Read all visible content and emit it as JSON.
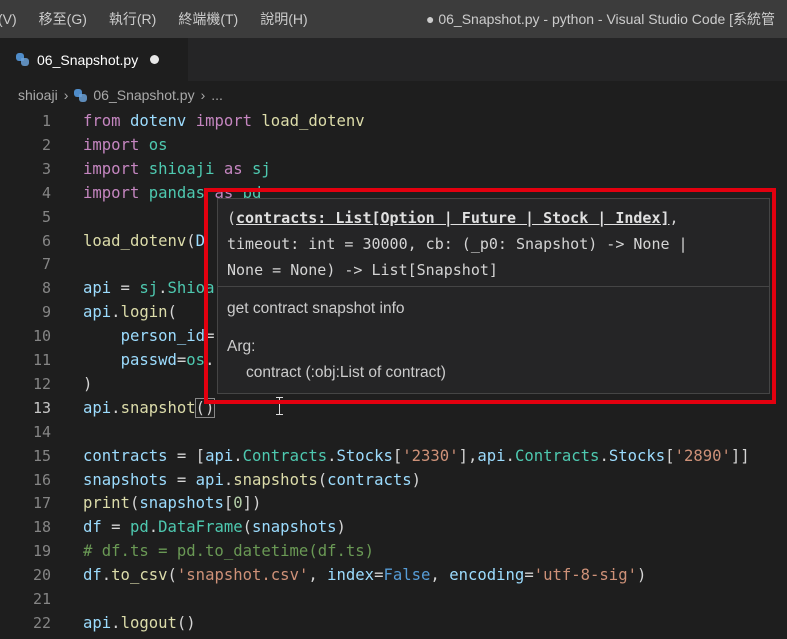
{
  "window": {
    "menu": [
      "(V)",
      "移至(G)",
      "執行(R)",
      "終端機(T)",
      "說明(H)"
    ],
    "title": "● 06_Snapshot.py - python - Visual Studio Code [系統管"
  },
  "tab": {
    "label": "06_Snapshot.py"
  },
  "breadcrumb": {
    "folder": "shioaji",
    "file": "06_Snapshot.py",
    "more": "...",
    "separator": "›"
  },
  "editor": {
    "active_line": 13,
    "lines": [
      {
        "n": "1",
        "tokens": [
          [
            "kw",
            "from"
          ],
          [
            "op",
            " "
          ],
          [
            "var",
            "dotenv"
          ],
          [
            "op",
            " "
          ],
          [
            "kw",
            "import"
          ],
          [
            "op",
            " "
          ],
          [
            "fn",
            "load_dotenv"
          ]
        ]
      },
      {
        "n": "2",
        "tokens": [
          [
            "kw",
            "import"
          ],
          [
            "op",
            " "
          ],
          [
            "cls",
            "os"
          ]
        ]
      },
      {
        "n": "3",
        "tokens": [
          [
            "kw",
            "import"
          ],
          [
            "op",
            " "
          ],
          [
            "cls",
            "shioaji"
          ],
          [
            "op",
            " "
          ],
          [
            "kw",
            "as"
          ],
          [
            "op",
            " "
          ],
          [
            "cls",
            "sj"
          ]
        ]
      },
      {
        "n": "4",
        "tokens": [
          [
            "kw",
            "import"
          ],
          [
            "op",
            " "
          ],
          [
            "cls",
            "pandas"
          ],
          [
            "op",
            " "
          ],
          [
            "kw",
            "as"
          ],
          [
            "op",
            " "
          ],
          [
            "cls",
            "pd"
          ]
        ]
      },
      {
        "n": "5",
        "tokens": []
      },
      {
        "n": "6",
        "tokens": [
          [
            "fn",
            "load_dotenv"
          ],
          [
            "op",
            "("
          ],
          [
            "var",
            "D"
          ]
        ]
      },
      {
        "n": "7",
        "tokens": []
      },
      {
        "n": "8",
        "tokens": [
          [
            "var",
            "api"
          ],
          [
            "op",
            " = "
          ],
          [
            "cls",
            "sj"
          ],
          [
            "op",
            "."
          ],
          [
            "cls",
            "Shioa"
          ]
        ]
      },
      {
        "n": "9",
        "tokens": [
          [
            "var",
            "api"
          ],
          [
            "op",
            "."
          ],
          [
            "fn",
            "login"
          ],
          [
            "op",
            "("
          ]
        ]
      },
      {
        "n": "10",
        "tokens": [
          [
            "op",
            "    "
          ],
          [
            "var",
            "person_id"
          ],
          [
            "op",
            "="
          ]
        ]
      },
      {
        "n": "11",
        "tokens": [
          [
            "op",
            "    "
          ],
          [
            "var",
            "passwd"
          ],
          [
            "op",
            "="
          ],
          [
            "cls",
            "os"
          ],
          [
            "op",
            "."
          ]
        ]
      },
      {
        "n": "12",
        "tokens": [
          [
            "op",
            ")"
          ]
        ]
      },
      {
        "n": "13",
        "tokens": [
          [
            "var",
            "api"
          ],
          [
            "op",
            "."
          ],
          [
            "fn",
            "snapshot"
          ],
          [
            "cursor",
            "()"
          ]
        ]
      },
      {
        "n": "14",
        "tokens": []
      },
      {
        "n": "15",
        "tokens": [
          [
            "var",
            "contracts"
          ],
          [
            "op",
            " = ["
          ],
          [
            "var",
            "api"
          ],
          [
            "op",
            "."
          ],
          [
            "cls",
            "Contracts"
          ],
          [
            "op",
            "."
          ],
          [
            "var",
            "Stocks"
          ],
          [
            "op",
            "["
          ],
          [
            "str",
            "'2330'"
          ],
          [
            "op",
            "],"
          ],
          [
            "var",
            "api"
          ],
          [
            "op",
            "."
          ],
          [
            "cls",
            "Contracts"
          ],
          [
            "op",
            "."
          ],
          [
            "var",
            "Stocks"
          ],
          [
            "op",
            "["
          ],
          [
            "str",
            "'2890'"
          ],
          [
            "op",
            "]]"
          ]
        ]
      },
      {
        "n": "16",
        "tokens": [
          [
            "var",
            "snapshots"
          ],
          [
            "op",
            " = "
          ],
          [
            "var",
            "api"
          ],
          [
            "op",
            "."
          ],
          [
            "fn",
            "snapshots"
          ],
          [
            "op",
            "("
          ],
          [
            "var",
            "contracts"
          ],
          [
            "op",
            ")"
          ]
        ]
      },
      {
        "n": "17",
        "tokens": [
          [
            "fn",
            "print"
          ],
          [
            "op",
            "("
          ],
          [
            "var",
            "snapshots"
          ],
          [
            "op",
            "["
          ],
          [
            "num",
            "0"
          ],
          [
            "op",
            "])"
          ]
        ]
      },
      {
        "n": "18",
        "tokens": [
          [
            "var",
            "df"
          ],
          [
            "op",
            " = "
          ],
          [
            "cls",
            "pd"
          ],
          [
            "op",
            "."
          ],
          [
            "cls",
            "DataFrame"
          ],
          [
            "op",
            "("
          ],
          [
            "var",
            "snapshots"
          ],
          [
            "op",
            ")"
          ]
        ]
      },
      {
        "n": "19",
        "tokens": [
          [
            "cm",
            "# df.ts = pd.to_datetime(df.ts)"
          ]
        ]
      },
      {
        "n": "20",
        "tokens": [
          [
            "var",
            "df"
          ],
          [
            "op",
            "."
          ],
          [
            "fn",
            "to_csv"
          ],
          [
            "op",
            "("
          ],
          [
            "str",
            "'snapshot.csv'"
          ],
          [
            "op",
            ", "
          ],
          [
            "var",
            "index"
          ],
          [
            "op",
            "="
          ],
          [
            "bool",
            "False"
          ],
          [
            "op",
            ", "
          ],
          [
            "var",
            "encoding"
          ],
          [
            "op",
            "="
          ],
          [
            "str",
            "'utf-8-sig'"
          ],
          [
            "op",
            ")"
          ]
        ]
      },
      {
        "n": "21",
        "tokens": []
      },
      {
        "n": "22",
        "tokens": [
          [
            "var",
            "api"
          ],
          [
            "op",
            "."
          ],
          [
            "fn",
            "logout"
          ],
          [
            "op",
            "()"
          ]
        ]
      }
    ]
  },
  "hover": {
    "sig_open": "(",
    "sig_param": "contracts: List[Option | Future | Stock | Index]",
    "sig_rest1": ",",
    "sig_line2": "timeout: int = 30000, cb: (_p0: Snapshot) -> None |",
    "sig_line3": "None = None) -> List[Snapshot]",
    "description": "get contract snapshot info",
    "arg_heading": "Arg:",
    "arg_item": "contract (:obj:List of contract)"
  },
  "colors": {
    "highlight_frame": "#e3000f",
    "editor_bg": "#1e1e1e",
    "title_bar": "#3c3c3c"
  }
}
